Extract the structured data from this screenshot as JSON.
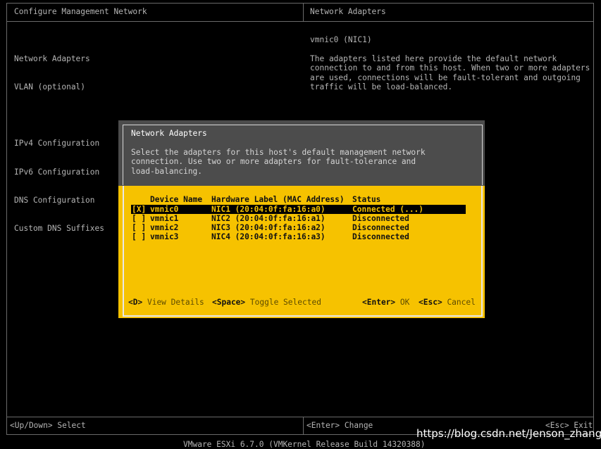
{
  "header": {
    "left_title": "Configure Management Network",
    "right_title": "Network Adapters"
  },
  "menu": {
    "group1": [
      "Network Adapters",
      "VLAN (optional)"
    ],
    "group2": [
      "IPv4 Configuration",
      "IPv6 Configuration",
      "DNS Configuration",
      "Custom DNS Suffixes"
    ]
  },
  "info": {
    "title": "vmnic0 (NIC1)",
    "description": "The adapters listed here provide the default network\nconnection to and from this host. When two or more adapters\nare used, connections will be fault-tolerant and outgoing\ntraffic will be load-balanced."
  },
  "dialog": {
    "title": "Network Adapters",
    "description": "Select the adapters for this host's default management network\nconnection. Use two or more adapters for fault-tolerance and\nload-balancing.",
    "columns": {
      "device": "Device Name",
      "hardware": "Hardware Label (MAC Address)",
      "status": "Status"
    },
    "rows": [
      {
        "check": "[X]",
        "device": "vmnic0",
        "hardware": "NIC1 (20:04:0f:fa:16:a0)",
        "status": "Connected (...)"
      },
      {
        "check": "[ ]",
        "device": "vmnic1",
        "hardware": "NIC2 (20:04:0f:fa:16:a1)",
        "status": "Disconnected"
      },
      {
        "check": "[ ]",
        "device": "vmnic2",
        "hardware": "NIC3 (20:04:0f:fa:16:a2)",
        "status": "Disconnected"
      },
      {
        "check": "[ ]",
        "device": "vmnic3",
        "hardware": "NIC4 (20:04:0f:fa:16:a3)",
        "status": "Disconnected"
      }
    ],
    "hotkeys": {
      "details_key": "<D>",
      "details_label": "View Details",
      "toggle_key": "<Space>",
      "toggle_label": "Toggle Selected",
      "ok_key": "<Enter>",
      "ok_label": "OK",
      "cancel_key": "<Esc>",
      "cancel_label": "Cancel"
    }
  },
  "status_bar": {
    "select": "<Up/Down> Select",
    "change": "<Enter> Change",
    "exit": "<Esc> Exit"
  },
  "footer": "VMware ESXi 6.7.0 (VMKernel Release Build 14320388)",
  "watermark": "https://blog.csdn.net/Jenson_zhang",
  "colors": {
    "background": "#000000",
    "dialog_accent": "#f6c200",
    "dialog_header": "#4c4c4c",
    "text_gray": "#b4b4b4"
  }
}
